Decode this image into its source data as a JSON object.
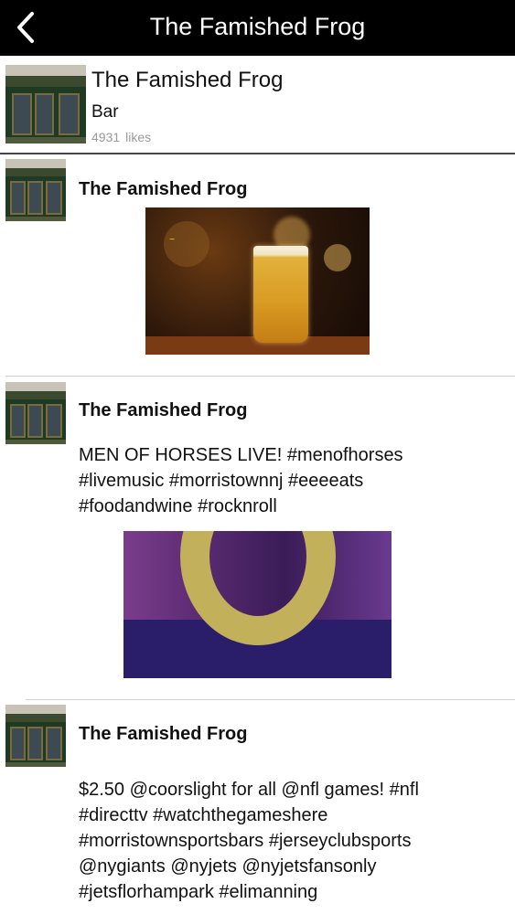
{
  "navbar": {
    "back_icon": "chevron-left-icon",
    "title": "The Famished Frog"
  },
  "profile": {
    "name": "The Famished Frog",
    "category": "Bar",
    "likes_count": "4931",
    "likes_label": "likes"
  },
  "posts": [
    {
      "author": "The Famished Frog",
      "text": "",
      "image": "beer-glass-image"
    },
    {
      "author": "The Famished Frog",
      "text_lines": [
        "MEN OF HORSES LIVE! #menofhorses",
        "#livemusic #morristownnj #eeeeats",
        "#foodandwine #rocknroll"
      ],
      "image": "stage-photo-image"
    },
    {
      "author": "The Famished Frog",
      "text_lines": [
        "$2.50 @coorslight for all @nfl games! #nfl",
        "#directtv #watchthegameshere",
        "#morristownsportsbars #jerseyclubsports",
        "@nygiants @nyjets @nyjetsfansonly",
        "#jetsflorhampark #elimanning"
      ]
    }
  ]
}
